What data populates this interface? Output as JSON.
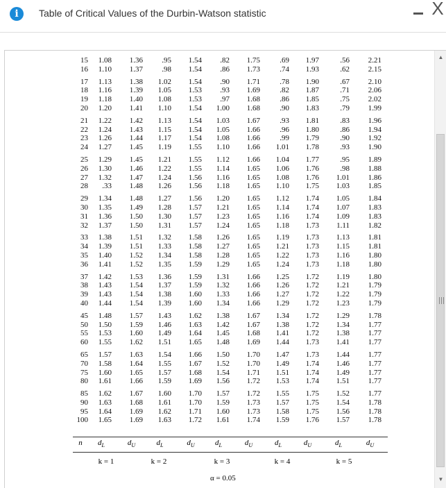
{
  "window": {
    "title": "Table of Critical Values of the Durbin-Watson statistic",
    "info_icon": "info-icon",
    "minimize_glyph": "–",
    "close_glyph": "X"
  },
  "table": {
    "groups": [
      [
        [
          "15",
          "1.08",
          "1.36",
          ".95",
          "1.54",
          ".82",
          "1.75",
          ".69",
          "1.97",
          ".56",
          "2.21"
        ],
        [
          "16",
          "1.10",
          "1.37",
          ".98",
          "1.54",
          ".86",
          "1.73",
          ".74",
          "1.93",
          ".62",
          "2.15"
        ]
      ],
      [
        [
          "17",
          "1.13",
          "1.38",
          "1.02",
          "1.54",
          ".90",
          "1.71",
          ".78",
          "1.90",
          ".67",
          "2.10"
        ],
        [
          "18",
          "1.16",
          "1.39",
          "1.05",
          "1.53",
          ".93",
          "1.69",
          ".82",
          "1.87",
          ".71",
          "2.06"
        ],
        [
          "19",
          "1.18",
          "1.40",
          "1.08",
          "1.53",
          ".97",
          "1.68",
          ".86",
          "1.85",
          ".75",
          "2.02"
        ],
        [
          "20",
          "1.20",
          "1.41",
          "1.10",
          "1.54",
          "1.00",
          "1.68",
          ".90",
          "1.83",
          ".79",
          "1.99"
        ]
      ],
      [
        [
          "21",
          "1.22",
          "1.42",
          "1.13",
          "1.54",
          "1.03",
          "1.67",
          ".93",
          "1.81",
          ".83",
          "1.96"
        ],
        [
          "22",
          "1.24",
          "1.43",
          "1.15",
          "1.54",
          "1.05",
          "1.66",
          ".96",
          "1.80",
          ".86",
          "1.94"
        ],
        [
          "23",
          "1.26",
          "1.44",
          "1.17",
          "1.54",
          "1.08",
          "1.66",
          ".99",
          "1.79",
          ".90",
          "1.92"
        ],
        [
          "24",
          "1.27",
          "1.45",
          "1.19",
          "1.55",
          "1.10",
          "1.66",
          "1.01",
          "1.78",
          ".93",
          "1.90"
        ]
      ],
      [
        [
          "25",
          "1.29",
          "1.45",
          "1.21",
          "1.55",
          "1.12",
          "1.66",
          "1.04",
          "1.77",
          ".95",
          "1.89"
        ],
        [
          "26",
          "1.30",
          "1.46",
          "1.22",
          "1.55",
          "1.14",
          "1.65",
          "1.06",
          "1.76",
          ".98",
          "1.88"
        ],
        [
          "27",
          "1.32",
          "1.47",
          "1.24",
          "1.56",
          "1.16",
          "1.65",
          "1.08",
          "1.76",
          "1.01",
          "1.86"
        ],
        [
          "28",
          ".33",
          "1.48",
          "1.26",
          "1.56",
          "1.18",
          "1.65",
          "1.10",
          "1.75",
          "1.03",
          "1.85"
        ]
      ],
      [
        [
          "29",
          "1.34",
          "1.48",
          "1.27",
          "1.56",
          "1.20",
          "1.65",
          "1.12",
          "1.74",
          "1.05",
          "1.84"
        ],
        [
          "30",
          "1.35",
          "1.49",
          "1.28",
          "1.57",
          "1.21",
          "1.65",
          "1.14",
          "1.74",
          "1.07",
          "1.83"
        ],
        [
          "31",
          "1.36",
          "1.50",
          "1.30",
          "1.57",
          "1.23",
          "1.65",
          "1.16",
          "1.74",
          "1.09",
          "1.83"
        ],
        [
          "32",
          "1.37",
          "1.50",
          "1.31",
          "1.57",
          "1.24",
          "1.65",
          "1.18",
          "1.73",
          "1.11",
          "1.82"
        ]
      ],
      [
        [
          "33",
          "1.38",
          "1.51",
          "1.32",
          "1.58",
          "1.26",
          "1.65",
          "1.19",
          "1.73",
          "1.13",
          "1.81"
        ],
        [
          "34",
          "1.39",
          "1.51",
          "1.33",
          "1.58",
          "1.27",
          "1.65",
          "1.21",
          "1.73",
          "1.15",
          "1.81"
        ],
        [
          "35",
          "1.40",
          "1.52",
          "1.34",
          "1.58",
          "1.28",
          "1.65",
          "1.22",
          "1.73",
          "1.16",
          "1.80"
        ],
        [
          "36",
          "1.41",
          "1.52",
          "1.35",
          "1.59",
          "1.29",
          "1.65",
          "1.24",
          "1.73",
          "1.18",
          "1.80"
        ]
      ],
      [
        [
          "37",
          "1.42",
          "1.53",
          "1.36",
          "1.59",
          "1.31",
          "1.66",
          "1.25",
          "1.72",
          "1.19",
          "1.80"
        ],
        [
          "38",
          "1.43",
          "1.54",
          "1.37",
          "1.59",
          "1.32",
          "1.66",
          "1.26",
          "1.72",
          "1.21",
          "1.79"
        ],
        [
          "39",
          "1.43",
          "1.54",
          "1.38",
          "1.60",
          "1.33",
          "1.66",
          "1.27",
          "1.72",
          "1.22",
          "1.79"
        ],
        [
          "40",
          "1.44",
          "1.54",
          "1.39",
          "1.60",
          "1.34",
          "1.66",
          "1.29",
          "1.72",
          "1.23",
          "1.79"
        ]
      ],
      [
        [
          "45",
          "1.48",
          "1.57",
          "1.43",
          "1.62",
          "1.38",
          "1.67",
          "1.34",
          "1.72",
          "1.29",
          "1.78"
        ],
        [
          "50",
          "1.50",
          "1.59",
          "1.46",
          "1.63",
          "1.42",
          "1.67",
          "1.38",
          "1.72",
          "1.34",
          "1.77"
        ],
        [
          "55",
          "1.53",
          "1.60",
          "1.49",
          "1.64",
          "1.45",
          "1.68",
          "1.41",
          "1.72",
          "1.38",
          "1.77"
        ],
        [
          "60",
          "1.55",
          "1.62",
          "1.51",
          "1.65",
          "1.48",
          "1.69",
          "1.44",
          "1.73",
          "1.41",
          "1.77"
        ]
      ],
      [
        [
          "65",
          "1.57",
          "1.63",
          "1.54",
          "1.66",
          "1.50",
          "1.70",
          "1.47",
          "1.73",
          "1.44",
          "1.77"
        ],
        [
          "70",
          "1.58",
          "1.64",
          "1.55",
          "1.67",
          "1.52",
          "1.70",
          "1.49",
          "1.74",
          "1.46",
          "1.77"
        ],
        [
          "75",
          "1.60",
          "1.65",
          "1.57",
          "1.68",
          "1.54",
          "1.71",
          "1.51",
          "1.74",
          "1.49",
          "1.77"
        ],
        [
          "80",
          "1.61",
          "1.66",
          "1.59",
          "1.69",
          "1.56",
          "1.72",
          "1.53",
          "1.74",
          "1.51",
          "1.77"
        ]
      ],
      [
        [
          "85",
          "1.62",
          "1.67",
          "1.60",
          "1.70",
          "1.57",
          "1.72",
          "1.55",
          "1.75",
          "1.52",
          "1.77"
        ],
        [
          "90",
          "1.63",
          "1.68",
          "1.61",
          "1.70",
          "1.59",
          "1.73",
          "1.57",
          "1.75",
          "1.54",
          "1.78"
        ],
        [
          "95",
          "1.64",
          "1.69",
          "1.62",
          "1.71",
          "1.60",
          "1.73",
          "1.58",
          "1.75",
          "1.56",
          "1.78"
        ],
        [
          "100",
          "1.65",
          "1.69",
          "1.63",
          "1.72",
          "1.61",
          "1.74",
          "1.59",
          "1.76",
          "1.57",
          "1.78"
        ]
      ]
    ],
    "header": [
      "n",
      "dL",
      "dU",
      "dL",
      "dU",
      "dL",
      "dU",
      "dL",
      "dU",
      "dL",
      "dU"
    ],
    "k_labels": [
      "k = 1",
      "k = 2",
      "k = 3",
      "k = 4",
      "k = 5"
    ],
    "alpha": "α = 0.05"
  },
  "scrollbar": {
    "up_glyph": "▲",
    "down_glyph": "▼"
  }
}
